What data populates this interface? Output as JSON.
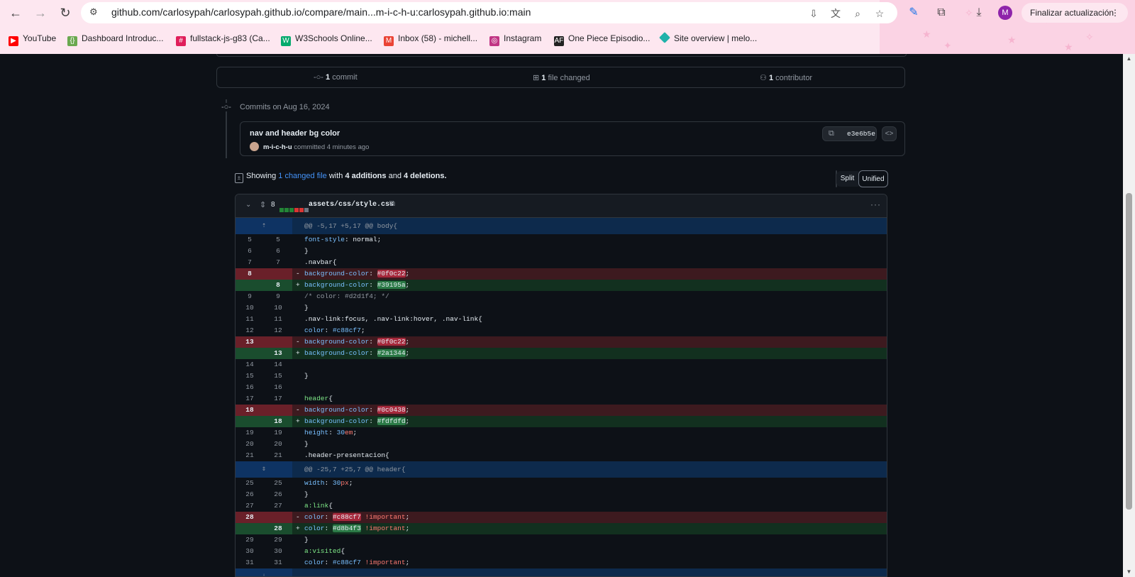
{
  "browser": {
    "url": "github.com/carlosypah/carlosypah.github.io/compare/main...m-i-c-h-u:carlosypah.github.io:main",
    "update_label": "Finalizar actualización",
    "avatar_letter": "M",
    "bookmarks": [
      {
        "label": "YouTube",
        "icon": "youtube-icon",
        "color": "#ff0000"
      },
      {
        "label": "Dashboard Introduc...",
        "icon": "dashboard-icon",
        "color": "#6aa84f"
      },
      {
        "label": "fullstack-js-g83 (Ca...",
        "icon": "slack-icon",
        "color": "#e01e5a"
      },
      {
        "label": "W3Schools Online...",
        "icon": "w3schools-icon",
        "color": "#04aa6d"
      },
      {
        "label": "Inbox (58) - michell...",
        "icon": "gmail-icon",
        "color": "#ea4335"
      },
      {
        "label": "Instagram",
        "icon": "instagram-icon",
        "color": "#c13584"
      },
      {
        "label": "One Piece Episodio...",
        "icon": "animeflv-icon",
        "color": "#222222"
      },
      {
        "label": "Site overview | melo...",
        "icon": "netlify-icon",
        "color": "#20b2aa"
      }
    ]
  },
  "summary": {
    "commits": {
      "count": "1",
      "label": "commit"
    },
    "files": {
      "count": "1",
      "label": "file changed"
    },
    "contributors": {
      "count": "1",
      "label": "contributor"
    }
  },
  "commits_header": "Commits on Aug 16, 2024",
  "commit": {
    "title": "nav and header bg color",
    "author": "m-i-c-h-u",
    "meta": "committed 4 minutes ago",
    "sha": "e3e6b5e"
  },
  "showing": {
    "prefix": "Showing",
    "changed_link": "1 changed file",
    "with": "with",
    "additions": "4 additions",
    "and": "and",
    "deletions": "4 deletions."
  },
  "view_toggle": {
    "split": "Split",
    "unified": "Unified",
    "selected": "Unified"
  },
  "file": {
    "changes": "8",
    "name": "assets/css/style.css",
    "bars": [
      "#238636",
      "#238636",
      "#238636",
      "#da3633",
      "#da3633",
      "#6e7681"
    ]
  },
  "hunks": [
    {
      "header": "@@ -5,17 +5,17 @@ body{"
    },
    {
      "header": "@@ -25,7 +25,7 @@ header{"
    }
  ],
  "colors": {
    "deleted_bg": "#3d1a1f",
    "added_bg": "#12301f",
    "link": "#4493f8"
  }
}
